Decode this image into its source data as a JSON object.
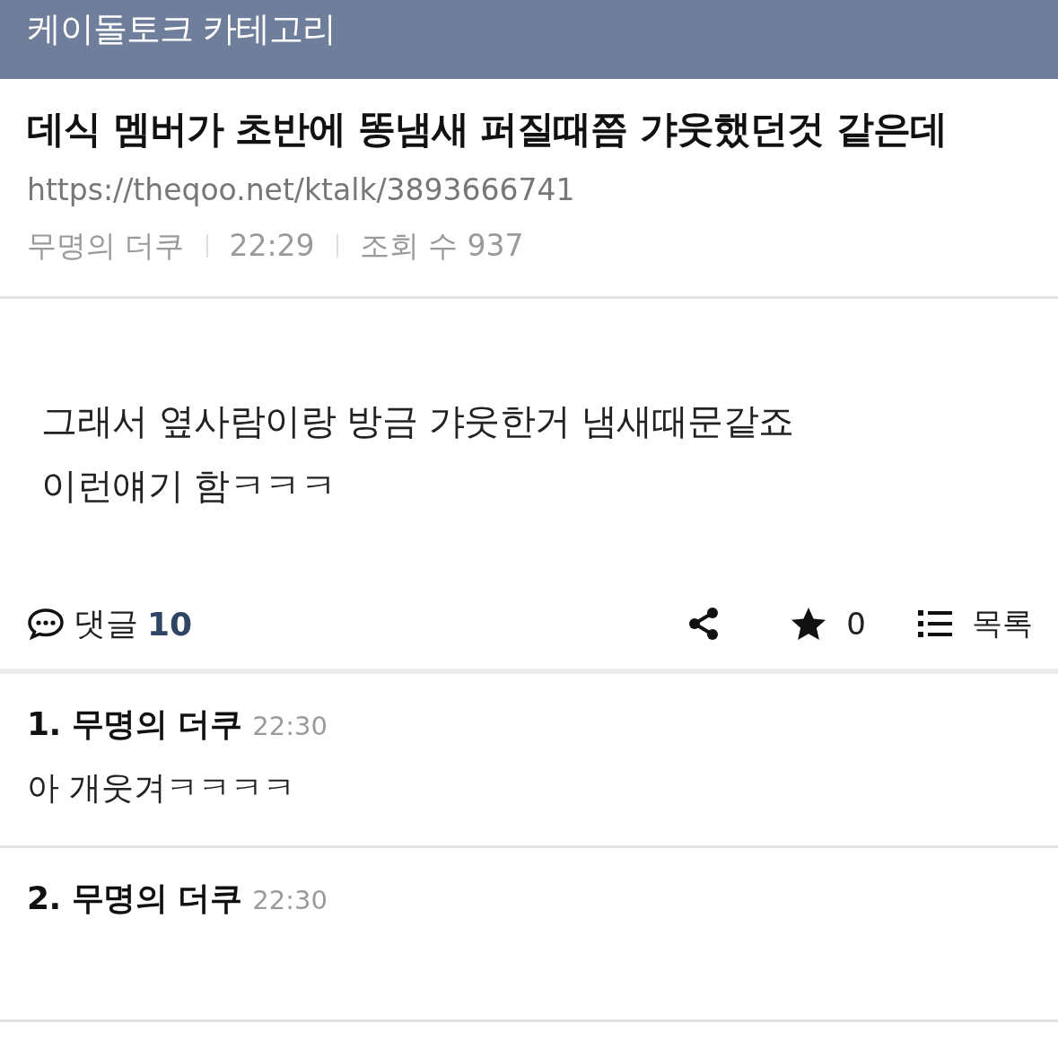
{
  "header": {
    "title": "케이돌토크 카테고리"
  },
  "post": {
    "title": "데식 멤버가 초반에 똥냄새 퍼질때쯤 갸웃했던것 같은데",
    "url": "https://theqoo.net/ktalk/3893666741",
    "meta": [
      "무명의 더쿠",
      "22:29",
      "조회 수 937"
    ],
    "body": [
      "그래서 옆사람이랑 방금 갸웃한거 냄새때문같죠",
      "이런얘기 함ㅋㅋㅋ"
    ]
  },
  "actions": {
    "comments_label": "댓글",
    "comments_count": "10",
    "star_count": "0",
    "list_label": "목록"
  },
  "comments": [
    {
      "heading": "1. 무명의 더쿠",
      "time": "22:30",
      "text": "아 개웃겨ㅋㅋㅋㅋ"
    },
    {
      "heading": "2. 무명의 더쿠",
      "time": "22:30"
    }
  ]
}
